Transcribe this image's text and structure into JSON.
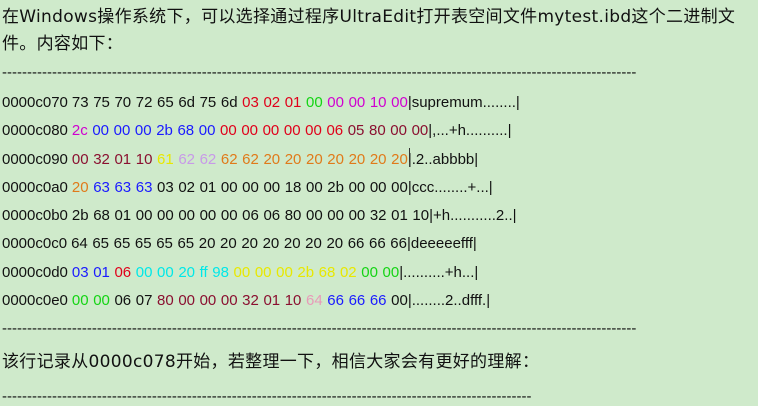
{
  "intro_text": "在Windows操作系统下，可以选择通过程序UltraEdit打开表空间文件mytest.ibd这个二进制文件。内容如下：",
  "separator": "-------------------------------------------------------------------------------------------------------------------------------",
  "separator_short": "----------------------------------------------------------------------------------------------------------",
  "colors": {
    "default": "#111111",
    "red": "#e0001a",
    "green": "#14d414",
    "magenta": "#d000d0",
    "blue": "#1a1aff",
    "yellow": "#e8e800",
    "orange": "#e07a1a",
    "pink": "#e89ab8",
    "maroon": "#8a1030",
    "cyan": "#00e8e8",
    "lavender": "#c89ae8",
    "dark": "#1a1a1a"
  },
  "hex_rows": [
    {
      "offset": "0000c070",
      "bytes": [
        {
          "v": "73",
          "c": "default"
        },
        {
          "v": "75",
          "c": "default"
        },
        {
          "v": "70",
          "c": "default"
        },
        {
          "v": "72",
          "c": "default"
        },
        {
          "v": "65",
          "c": "default"
        },
        {
          "v": "6d",
          "c": "default"
        },
        {
          "v": "75",
          "c": "default"
        },
        {
          "v": "6d",
          "c": "default"
        },
        {
          "v": "03",
          "c": "red"
        },
        {
          "v": "02",
          "c": "red"
        },
        {
          "v": "01",
          "c": "red"
        },
        {
          "v": "00",
          "c": "green"
        },
        {
          "v": "00",
          "c": "magenta"
        },
        {
          "v": "00",
          "c": "magenta"
        },
        {
          "v": "10",
          "c": "magenta"
        },
        {
          "v": "00",
          "c": "magenta"
        }
      ],
      "ascii": "|supremum........|"
    },
    {
      "offset": "0000c080",
      "bytes": [
        {
          "v": "2c",
          "c": "magenta"
        },
        {
          "v": "00",
          "c": "blue"
        },
        {
          "v": "00",
          "c": "blue"
        },
        {
          "v": "00",
          "c": "blue"
        },
        {
          "v": "2b",
          "c": "blue"
        },
        {
          "v": "68",
          "c": "blue"
        },
        {
          "v": "00",
          "c": "blue"
        },
        {
          "v": "00",
          "c": "red"
        },
        {
          "v": "00",
          "c": "red"
        },
        {
          "v": "00",
          "c": "red"
        },
        {
          "v": "00",
          "c": "red"
        },
        {
          "v": "00",
          "c": "red"
        },
        {
          "v": "06",
          "c": "red"
        },
        {
          "v": "05",
          "c": "maroon"
        },
        {
          "v": "80",
          "c": "maroon"
        },
        {
          "v": "00",
          "c": "maroon"
        }
      ],
      "extra": {
        "v": "00",
        "c": "maroon"
      },
      "ascii": "|,...+h..........|"
    },
    {
      "offset": "0000c090",
      "bytes": [
        {
          "v": "00",
          "c": "maroon"
        },
        {
          "v": "32",
          "c": "maroon"
        },
        {
          "v": "01",
          "c": "maroon"
        },
        {
          "v": "10",
          "c": "maroon"
        },
        {
          "v": "61",
          "c": "yellow"
        },
        {
          "v": "62",
          "c": "lavender"
        },
        {
          "v": "62",
          "c": "lavender"
        },
        {
          "v": "62",
          "c": "orange"
        },
        {
          "v": "62",
          "c": "orange"
        },
        {
          "v": "20",
          "c": "orange"
        },
        {
          "v": "20",
          "c": "orange"
        },
        {
          "v": "20",
          "c": "orange"
        },
        {
          "v": "20",
          "c": "orange"
        },
        {
          "v": "20",
          "c": "orange"
        },
        {
          "v": "20",
          "c": "orange"
        },
        {
          "v": "20",
          "c": "orange"
        }
      ],
      "ascii": "|.2..abbbb|"
    },
    {
      "offset": "0000c0a0",
      "bytes": [
        {
          "v": "20",
          "c": "orange"
        },
        {
          "v": "63",
          "c": "blue"
        },
        {
          "v": "63",
          "c": "blue"
        },
        {
          "v": "63",
          "c": "blue"
        },
        {
          "v": "03",
          "c": "default"
        },
        {
          "v": "02",
          "c": "default"
        },
        {
          "v": "01",
          "c": "default"
        },
        {
          "v": "00",
          "c": "default"
        },
        {
          "v": "00",
          "c": "default"
        },
        {
          "v": "00",
          "c": "default"
        },
        {
          "v": "18",
          "c": "default"
        },
        {
          "v": "00",
          "c": "default"
        },
        {
          "v": "2b",
          "c": "default"
        },
        {
          "v": "00",
          "c": "default"
        },
        {
          "v": "00",
          "c": "default"
        },
        {
          "v": "00",
          "c": "default"
        }
      ],
      "ascii": "|ccc........+...|"
    },
    {
      "offset": "0000c0b0",
      "bytes": [
        {
          "v": "2b",
          "c": "default"
        },
        {
          "v": "68",
          "c": "default"
        },
        {
          "v": "01",
          "c": "default"
        },
        {
          "v": "00",
          "c": "default"
        },
        {
          "v": "00",
          "c": "default"
        },
        {
          "v": "00",
          "c": "default"
        },
        {
          "v": "00",
          "c": "default"
        },
        {
          "v": "00",
          "c": "default"
        },
        {
          "v": "06",
          "c": "default"
        },
        {
          "v": "06",
          "c": "default"
        },
        {
          "v": "80",
          "c": "default"
        },
        {
          "v": "00",
          "c": "default"
        },
        {
          "v": "00",
          "c": "default"
        },
        {
          "v": "00",
          "c": "default"
        },
        {
          "v": "32",
          "c": "default"
        },
        {
          "v": "01",
          "c": "default"
        }
      ],
      "extra": {
        "v": "10",
        "c": "default"
      },
      "ascii": "|+h...........2..|"
    },
    {
      "offset": "0000c0c0",
      "bytes": [
        {
          "v": "64",
          "c": "default"
        },
        {
          "v": "65",
          "c": "default"
        },
        {
          "v": "65",
          "c": "default"
        },
        {
          "v": "65",
          "c": "default"
        },
        {
          "v": "65",
          "c": "default"
        },
        {
          "v": "65",
          "c": "default"
        },
        {
          "v": "20",
          "c": "default"
        },
        {
          "v": "20",
          "c": "default"
        },
        {
          "v": "20",
          "c": "default"
        },
        {
          "v": "20",
          "c": "default"
        },
        {
          "v": "20",
          "c": "default"
        },
        {
          "v": "20",
          "c": "default"
        },
        {
          "v": "20",
          "c": "default"
        },
        {
          "v": "66",
          "c": "default"
        },
        {
          "v": "66",
          "c": "default"
        },
        {
          "v": "66",
          "c": "default"
        }
      ],
      "ascii": "|deeeeefff|"
    },
    {
      "offset": "0000c0d0",
      "bytes": [
        {
          "v": "03",
          "c": "blue"
        },
        {
          "v": "01",
          "c": "blue"
        },
        {
          "v": "06",
          "c": "red"
        },
        {
          "v": "00",
          "c": "cyan"
        },
        {
          "v": "00",
          "c": "cyan"
        },
        {
          "v": "20",
          "c": "cyan"
        },
        {
          "v": "ff",
          "c": "cyan"
        },
        {
          "v": "98",
          "c": "cyan"
        },
        {
          "v": "00",
          "c": "yellow"
        },
        {
          "v": "00",
          "c": "yellow"
        },
        {
          "v": "00",
          "c": "yellow"
        },
        {
          "v": "2b",
          "c": "yellow"
        },
        {
          "v": "68",
          "c": "yellow"
        },
        {
          "v": "02",
          "c": "yellow"
        },
        {
          "v": "00",
          "c": "green"
        },
        {
          "v": "00",
          "c": "green"
        }
      ],
      "ascii": "|..........+h...|"
    },
    {
      "offset": "0000c0e0",
      "bytes": [
        {
          "v": "00",
          "c": "green"
        },
        {
          "v": "00",
          "c": "green"
        },
        {
          "v": "06",
          "c": "default"
        },
        {
          "v": "07",
          "c": "default"
        },
        {
          "v": "80",
          "c": "maroon"
        },
        {
          "v": "00",
          "c": "maroon"
        },
        {
          "v": "00",
          "c": "maroon"
        },
        {
          "v": "00",
          "c": "maroon"
        },
        {
          "v": "32",
          "c": "maroon"
        },
        {
          "v": "01",
          "c": "maroon"
        },
        {
          "v": "10",
          "c": "maroon"
        },
        {
          "v": "64",
          "c": "pink"
        },
        {
          "v": "66",
          "c": "blue"
        },
        {
          "v": "66",
          "c": "blue"
        },
        {
          "v": "66",
          "c": "blue"
        },
        {
          "v": "00",
          "c": "default"
        }
      ],
      "ascii": "|........2..dfff.|"
    }
  ],
  "note_text": "该行记录从0000c078开始，若整理一下，相信大家会有更好的理解："
}
